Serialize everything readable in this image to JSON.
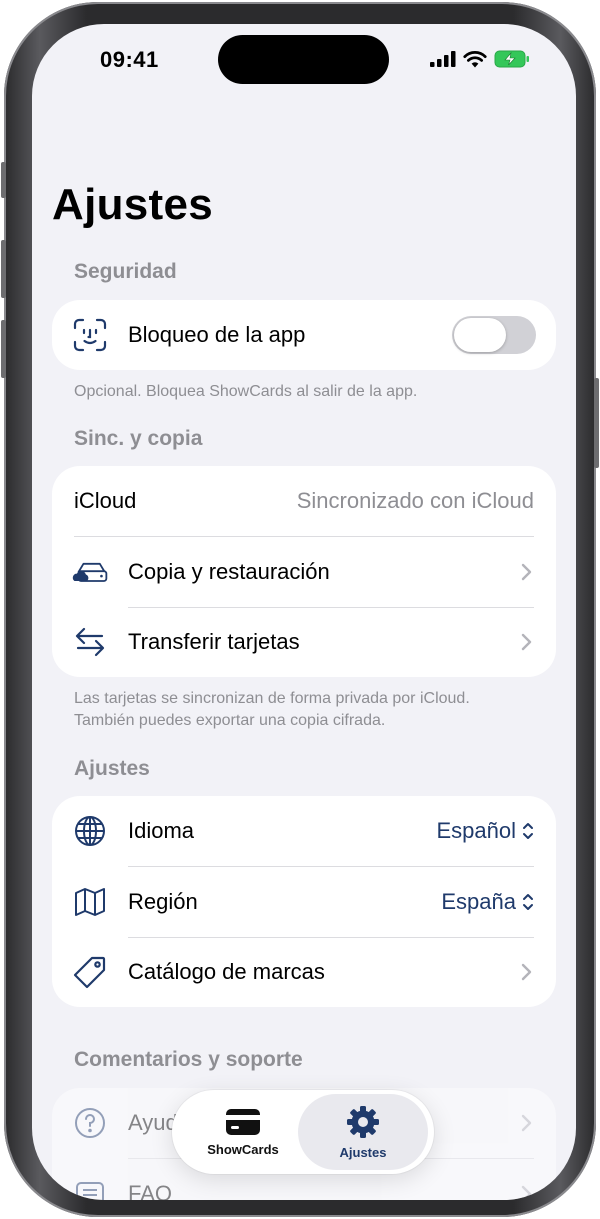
{
  "status_bar": {
    "time": "09:41"
  },
  "page": {
    "title": "Ajustes"
  },
  "colors": {
    "accent": "#1f3a6b",
    "background": "#f2f2f7",
    "secondary_text": "#8e8e93"
  },
  "sections": {
    "security": {
      "header": "Seguridad",
      "app_lock": {
        "label": "Bloqueo de la app",
        "icon": "face-id-icon",
        "toggle_on": false
      },
      "footer": "Opcional. Bloquea ShowCards al salir de la app."
    },
    "sync": {
      "header": "Sinc. y copia",
      "icloud": {
        "label": "iCloud",
        "value": "Sincronizado con iCloud"
      },
      "backup": {
        "label": "Copia y restauración",
        "icon": "cloud-drive-icon"
      },
      "transfer": {
        "label": "Transferir tarjetas",
        "icon": "arrows-transfer-icon"
      },
      "footer_line1": "Las tarjetas se sincronizan de forma privada por iCloud.",
      "footer_line2": "También puedes exportar una copia cifrada."
    },
    "settings": {
      "header": "Ajustes",
      "language": {
        "label": "Idioma",
        "value": "Español",
        "icon": "globe-icon"
      },
      "region": {
        "label": "Región",
        "value": "España",
        "icon": "map-icon"
      },
      "brands": {
        "label": "Catálogo de marcas",
        "icon": "tag-icon"
      }
    },
    "support": {
      "header": "Comentarios y soporte",
      "help": {
        "label": "Ayuda",
        "icon": "question-icon"
      },
      "faq": {
        "label": "FAQ",
        "icon": "list-icon"
      }
    }
  },
  "tab_bar": {
    "tabs": [
      {
        "label": "ShowCards",
        "icon": "card-icon",
        "active": false
      },
      {
        "label": "Ajustes",
        "icon": "gear-icon",
        "active": true
      }
    ]
  }
}
